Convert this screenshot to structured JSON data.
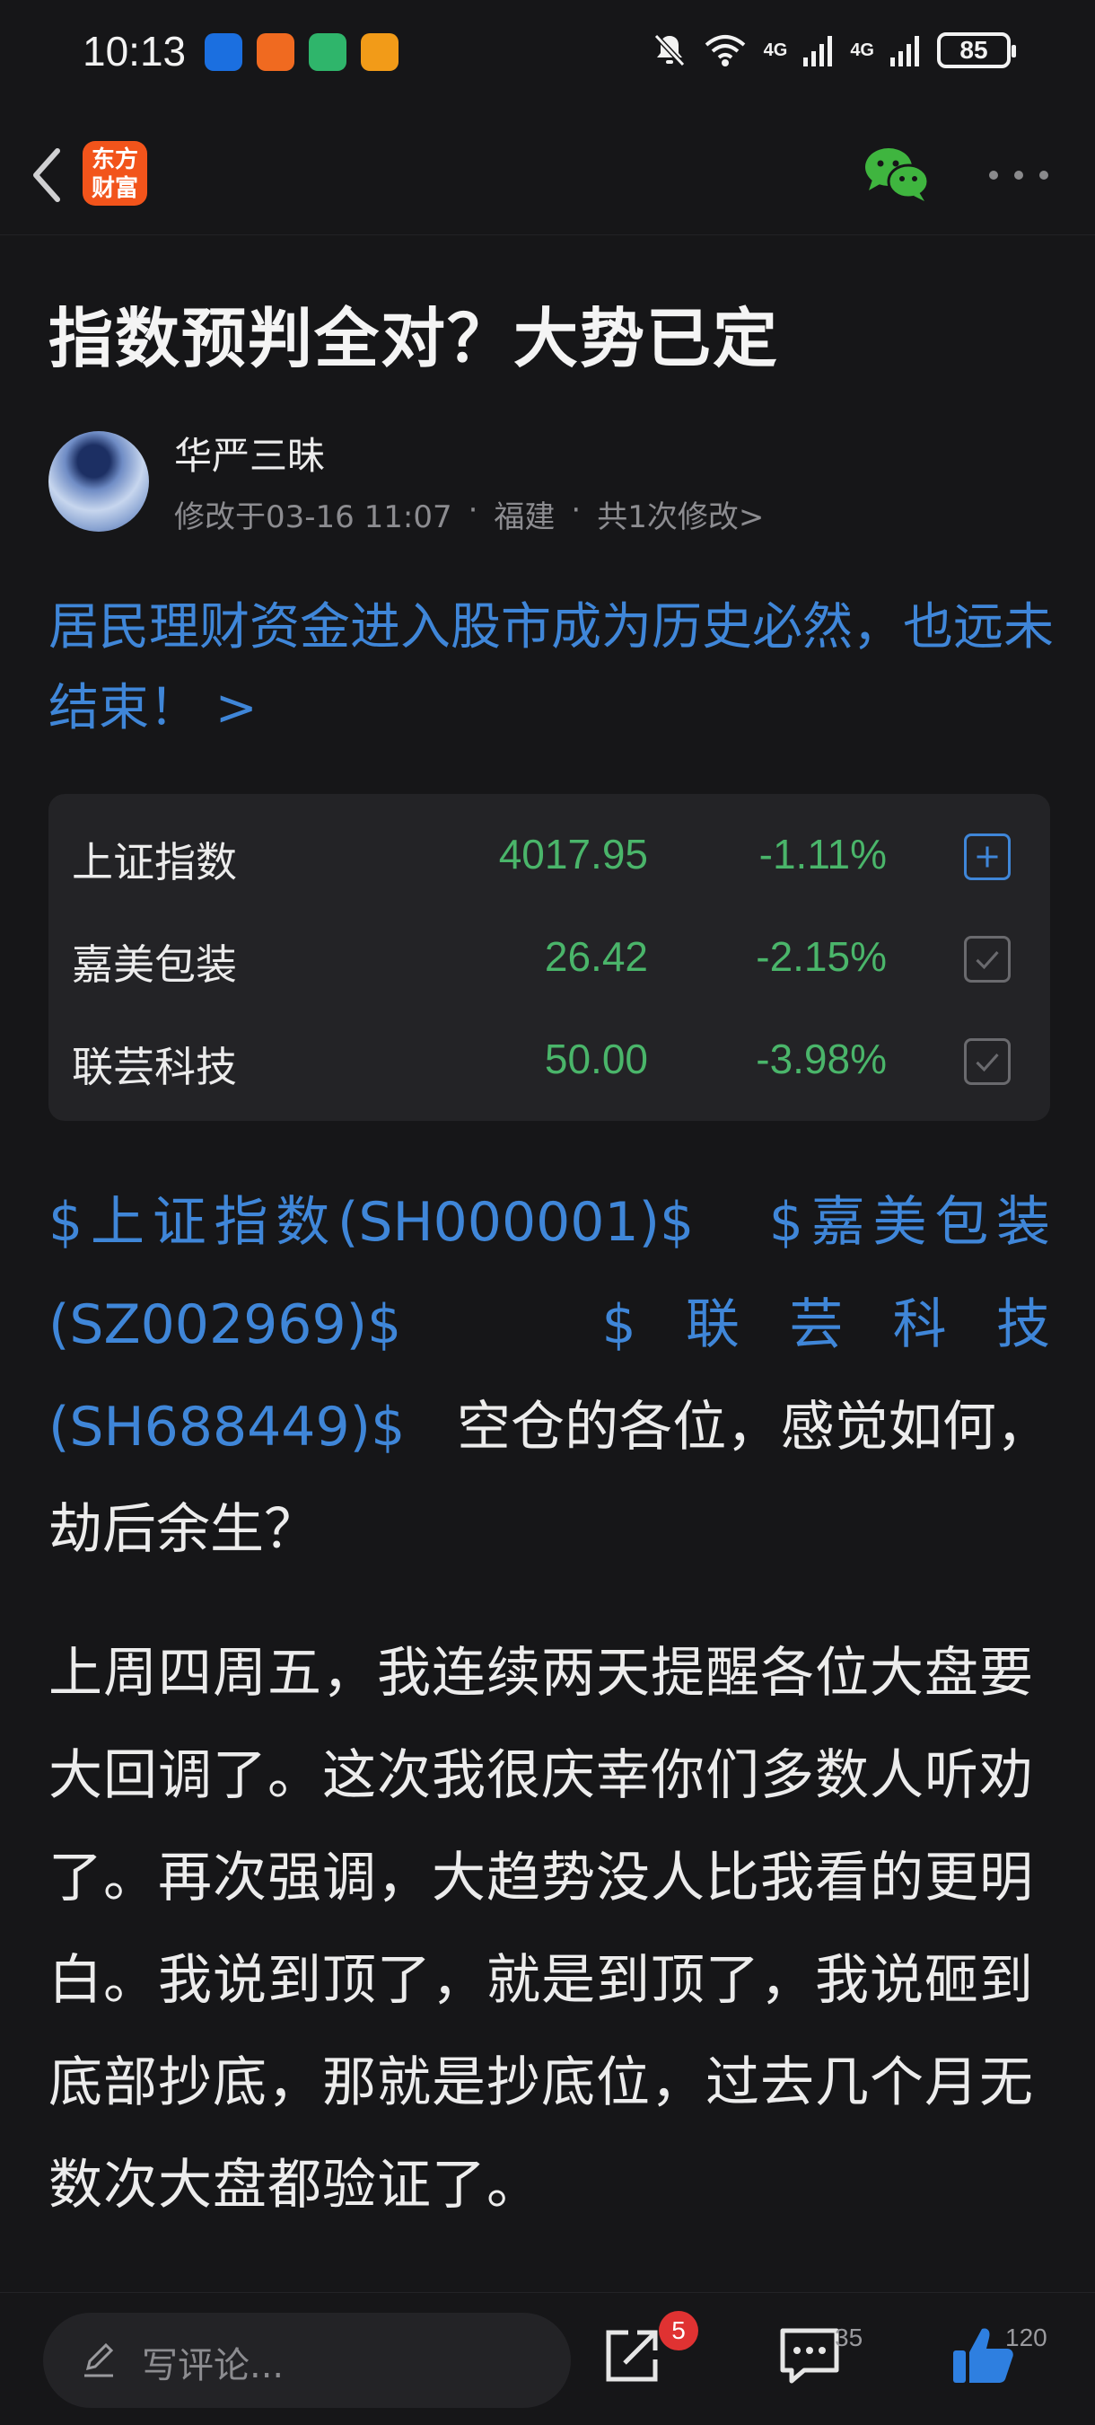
{
  "status_bar": {
    "time": "10:13",
    "network_1": "4G",
    "network_2": "4G",
    "battery": "85"
  },
  "nav": {
    "logo_line1": "东方",
    "logo_line2": "财富",
    "icons": [
      "back-icon",
      "wechat-icon",
      "more-icon"
    ]
  },
  "article": {
    "title": "指数预判全对？大势已定",
    "author": "华严三昧",
    "modified": "修改于03-16 11:07",
    "location": "福建",
    "edits": "共1次修改>",
    "topic_link": "居民理财资金进入股市成为历史必然，也远未结束！ >"
  },
  "stocks": [
    {
      "name": "上证指数",
      "price": "4017.95",
      "change": "-1.11%",
      "action": "add"
    },
    {
      "name": "嘉美包装",
      "price": "26.42",
      "change": "-2.15%",
      "action": "added"
    },
    {
      "name": "联芸科技",
      "price": "50.00",
      "change": "-3.98%",
      "action": "added"
    }
  ],
  "body": {
    "tag1": "$上证指数(SH000001)$",
    "tag2": "$嘉美包装(SZ002969)$",
    "tag3": "$联芸科技(SH688449)$",
    "p1_text": "空仓的各位，感觉如何，劫后余生？",
    "p2": "上周四周五，我连续两天提醒各位大盘要大回调了。这次我很庆幸你们多数人听劝了。再次强调，大趋势没人比我看的更明白。我说到顶了，就是到顶了，我说砸到底部抄底，那就是抄底位，过去几个月无数次大盘都验证了。"
  },
  "bottom_bar": {
    "comment_placeholder": "写评论...",
    "share_badge": "5",
    "comment_count": "35",
    "like_count": "120"
  },
  "colors": {
    "accent_blue": "#3f86d8",
    "down_green": "#4ab56a",
    "brand_orange": "#f2541b",
    "badge_red": "#e03232",
    "wechat_green": "#3fb53f"
  }
}
